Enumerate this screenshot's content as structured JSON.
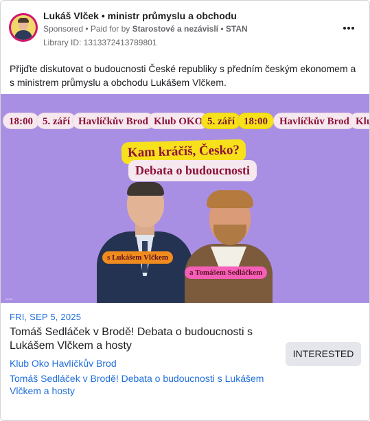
{
  "header": {
    "page_name": "Lukáš Vlček • ministr průmyslu a obchodu",
    "sponsored": "Sponsored",
    "paid_for_prefix": " • Paid for by ",
    "paid_for_by": "Starostové a nezávislí • STAN",
    "library_id": "Library ID: 1313372413789801",
    "more_icon": "more-horizontal-icon"
  },
  "body_text": "Přijďte diskutovat o budoucnosti České republiky s předním českým ekonomem a s ministrem průmyslu a obchodu Lukášem Vlčkem.",
  "creative": {
    "background": "#a98fe3",
    "pills": [
      "18:00",
      "5. září",
      "Havlíčkův Brod",
      "Klub OKO",
      "5. září",
      "18:00",
      "Havlíčkův Brod",
      "Klub"
    ],
    "headline_1": "Kam kráčíš, Česko?",
    "headline_2": "Debata o budoucnosti",
    "tag_1": "s Lukášem Vlčkem",
    "tag_2": "a Tomášem Sedláčkem",
    "footer_tiny": "STAN"
  },
  "event": {
    "date": "FRI, SEP 5, 2025",
    "title": "Tomáš Sedláček v Brodě! Debata o budoucnosti s Lukášem Vlčkem a hosty",
    "venue": "Klub Oko Havlíčkův Brod",
    "link_text": "Tomáš Sedláček v Brodě! Debata o budoucnosti s Lukášem Vlčkem a hosty",
    "button_label": "INTERESTED"
  },
  "colors": {
    "link_blue": "#216fdb",
    "accent_pink": "#d1166e",
    "highlight_yellow": "#f7e11b"
  }
}
